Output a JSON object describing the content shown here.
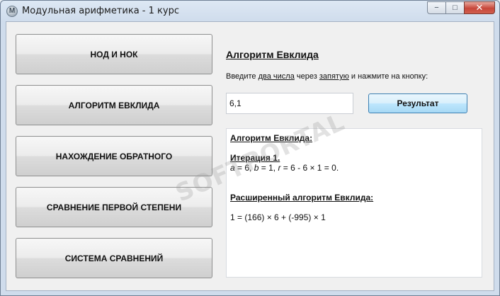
{
  "window": {
    "title": "Модульная арифметика - 1 курс",
    "icon_letter": "M",
    "controls": {
      "minimize": "−",
      "maximize": "□",
      "close": "✕"
    }
  },
  "nav": {
    "items": [
      {
        "label": "НОД И НОК"
      },
      {
        "label": "АЛГОРИТМ ЕВКЛИДА"
      },
      {
        "label": "НАХОЖДЕНИЕ ОБРАТНОГО"
      },
      {
        "label": "СРАВНЕНИЕ ПЕРВОЙ СТЕПЕНИ"
      },
      {
        "label": "СИСТЕМА СРАВНЕНИЙ"
      }
    ]
  },
  "main": {
    "heading": "Алгоритм Евклида",
    "instruction": {
      "p1": "Введите ",
      "p2": "два числа",
      "p3": " через ",
      "p4": "запятую",
      "p5": " и нажмите на кнопку:"
    },
    "input_value": "6,1",
    "result_button": "Результат",
    "output": {
      "title": "Алгоритм Евклида:",
      "iteration": "Итерация 1.",
      "a_var": "a",
      "a_eq": " = 6, ",
      "b_var": "b",
      "b_eq": " = 1, ",
      "r_var": "r",
      "r_eq": " = 6 - 6 × 1 = 0.",
      "extended_title": "Расширенный алгоритм Евклида:",
      "extended_result": "1 = (166) × 6 + (-995) × 1"
    }
  },
  "watermark": "SOFTPORTAL"
}
